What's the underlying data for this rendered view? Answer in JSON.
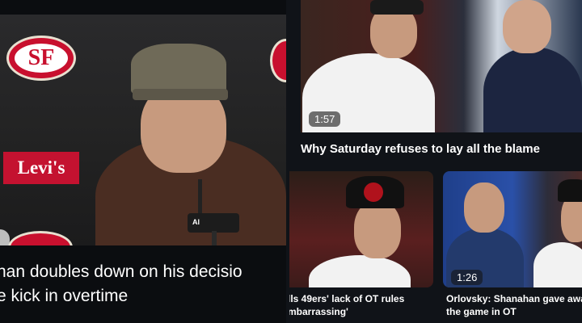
{
  "feature": {
    "title_line1": "han doubles down on his decisio",
    "title_line2": "e kick in overtime",
    "backdrop_logo_text": "SF",
    "sponsor_logo_text": "Levi's",
    "mic_label": "Al"
  },
  "top_story": {
    "duration": "1:57",
    "title": "Why Saturday refuses to lay all the blame"
  },
  "bottom_a": {
    "title_line1": "lls 49ers' lack of OT rules",
    "title_line2": "mbarrassing'"
  },
  "bottom_b": {
    "duration": "1:26",
    "title_line1": "Orlovsky: Shanahan gave away",
    "title_line2": "the game in OT"
  },
  "colors": {
    "background": "#101318",
    "niners_red": "#c8102e",
    "levis_red": "#c41230"
  }
}
